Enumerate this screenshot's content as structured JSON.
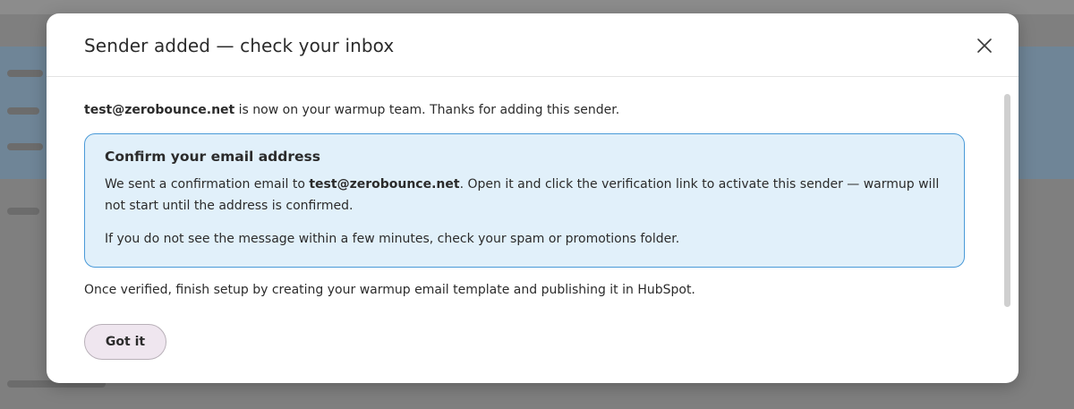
{
  "modal": {
    "title": "Sender added — check your inbox",
    "close_icon": "close-icon",
    "intro_email": "test@zerobounce.net",
    "intro_rest": " is now on your warmup team. Thanks for adding this sender.",
    "info": {
      "title": "Confirm your email address",
      "line1_prefix": "We sent a confirmation email to ",
      "line1_email": "test@zerobounce.net",
      "line1_suffix": ". Open it and click the verification link to activate this sender — warmup will not start until the address is confirmed.",
      "line2": "If you do not see the message within a few minutes, check your spam or promotions folder."
    },
    "outro": "Once verified, finish setup by creating your warmup email template and publishing it in HubSpot.",
    "button_label": "Got it"
  },
  "colors": {
    "info_bg": "#e1f0fa",
    "info_border": "#4a9ad8",
    "button_bg": "#efe6ef"
  }
}
